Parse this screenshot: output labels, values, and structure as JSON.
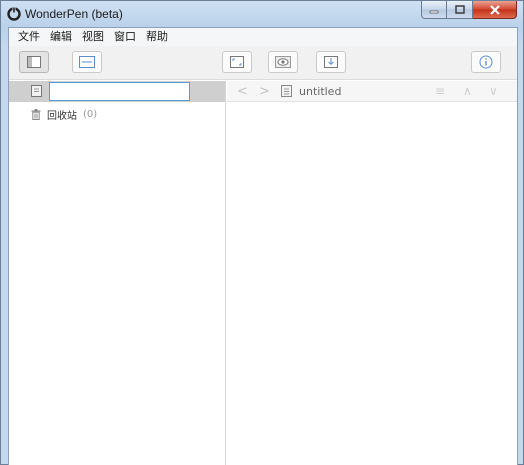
{
  "window": {
    "title": "WonderPen (beta)",
    "accent_close": "#c2331b"
  },
  "menu": {
    "items": [
      "文件",
      "编辑",
      "视图",
      "窗口",
      "帮助"
    ]
  },
  "toolbar": {
    "buttons": [
      "sidebar-toggle-icon",
      "single-pane-icon",
      "fullscreen-icon",
      "preview-icon",
      "export-icon",
      "info-icon"
    ]
  },
  "sidebar": {
    "search_value": "",
    "trash_label": "回收站",
    "trash_count": "(0)"
  },
  "editor": {
    "back": "<",
    "forward": ">",
    "doc_title": "untitled",
    "outline_icon": "≡",
    "up_icon": "∧",
    "down_icon": "∨"
  }
}
